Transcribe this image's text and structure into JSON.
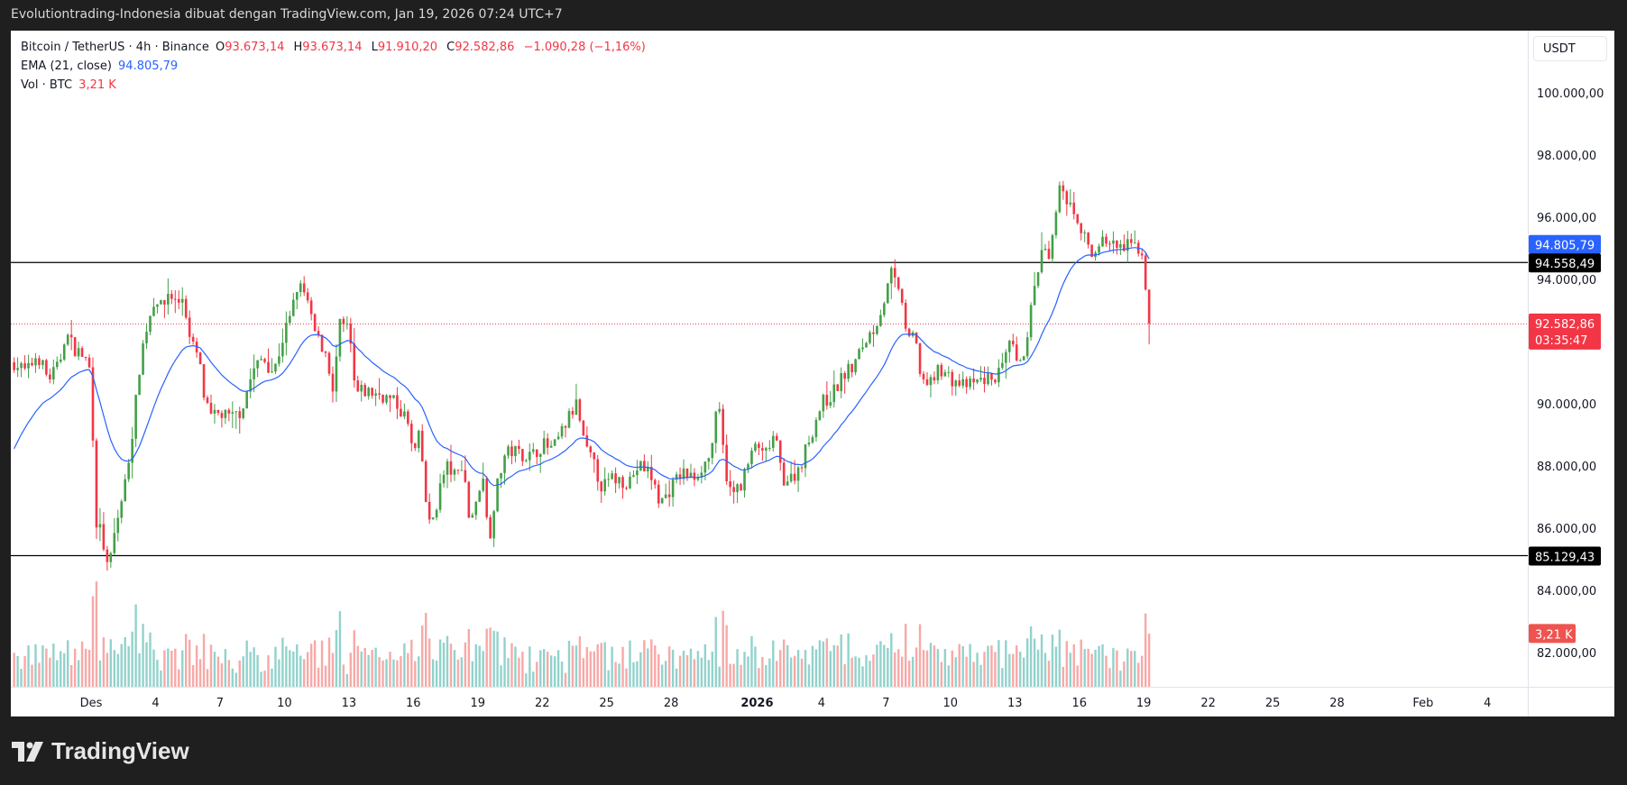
{
  "topbar": {
    "caption": "Evolutiontrading-Indonesia dibuat dengan TradingView.com, Jan 19, 2026 07:24 UTC+7"
  },
  "legend": {
    "symbol": "Bitcoin / TetherUS · 4h · Binance",
    "o_label": "O",
    "o_value": "93.673,14",
    "h_label": "H",
    "h_value": "93.673,14",
    "l_label": "L",
    "l_value": "91.910,20",
    "c_label": "C",
    "c_value": "92.582,86",
    "change": "−1.090,28 (−1,16%)",
    "ema_label": "EMA (21, close)",
    "ema_value": "94.805,79",
    "vol_label": "Vol · BTC",
    "vol_value": "3,21 K"
  },
  "price_axis": {
    "currency": "USDT",
    "ticks": [
      {
        "value": 100000,
        "label": "100.000,00"
      },
      {
        "value": 98000,
        "label": "98.000,00"
      },
      {
        "value": 96000,
        "label": "96.000,00"
      },
      {
        "value": 94000,
        "label": "94.000,00"
      },
      {
        "value": 90000,
        "label": "90.000,00"
      },
      {
        "value": 88000,
        "label": "88.000,00"
      },
      {
        "value": 86000,
        "label": "86.000,00"
      },
      {
        "value": 84000,
        "label": "84.000,00"
      },
      {
        "value": 82000,
        "label": "82.000,00"
      }
    ],
    "badges": {
      "ema": {
        "value": 94805.79,
        "label": "94.805,79",
        "color": "#2962ff"
      },
      "resistance": {
        "value": 94558.49,
        "label": "94.558,49",
        "color": "#000000"
      },
      "last": {
        "value": 92582.86,
        "label": "92.582,86",
        "countdown": "03:35:47",
        "color": "#f23645"
      },
      "support": {
        "value": 85129.43,
        "label": "85.129,43",
        "color": "#000000"
      },
      "volume": {
        "value": 3.21,
        "label": "3,21 K",
        "color": "#ef5350"
      }
    }
  },
  "time_axis": {
    "ticks": [
      {
        "day": 0,
        "label": "Des"
      },
      {
        "day": 3,
        "label": "4"
      },
      {
        "day": 6,
        "label": "7"
      },
      {
        "day": 9,
        "label": "10"
      },
      {
        "day": 12,
        "label": "13"
      },
      {
        "day": 15,
        "label": "16"
      },
      {
        "day": 18,
        "label": "19"
      },
      {
        "day": 21,
        "label": "22"
      },
      {
        "day": 24,
        "label": "25"
      },
      {
        "day": 27,
        "label": "28"
      },
      {
        "day": 31,
        "label": "2026",
        "bold": true
      },
      {
        "day": 34,
        "label": "4"
      },
      {
        "day": 37,
        "label": "7"
      },
      {
        "day": 40,
        "label": "10"
      },
      {
        "day": 43,
        "label": "13"
      },
      {
        "day": 46,
        "label": "16"
      },
      {
        "day": 49,
        "label": "19"
      },
      {
        "day": 52,
        "label": "22"
      },
      {
        "day": 55,
        "label": "25"
      },
      {
        "day": 58,
        "label": "28"
      },
      {
        "day": 62,
        "label": "Feb"
      },
      {
        "day": 65,
        "label": "4"
      }
    ]
  },
  "chart_data": {
    "type": "candlestick",
    "title": "Bitcoin / TetherUS · 4h · Binance",
    "day_origin": "Dec 1, 2025",
    "ylim": [
      80500,
      101500
    ],
    "horizontal_lines": [
      94558.49,
      85129.43
    ],
    "ema_period": 21,
    "last_candle": {
      "open": 93673.14,
      "high": 93673.14,
      "low": 91910.2,
      "close": 92582.86,
      "volume_k": 3.21
    },
    "close_path_day_price": [
      [
        -3.7,
        91400
      ],
      [
        -3,
        91000
      ],
      [
        -2.5,
        91600
      ],
      [
        -2,
        90800
      ],
      [
        -1.5,
        91200
      ],
      [
        -1.2,
        92300
      ],
      [
        -0.8,
        91800
      ],
      [
        -0.3,
        91500
      ],
      [
        0,
        91000
      ],
      [
        0.2,
        86300
      ],
      [
        0.5,
        85800
      ],
      [
        0.8,
        84500
      ],
      [
        1.0,
        85500
      ],
      [
        1.3,
        86500
      ],
      [
        1.6,
        87500
      ],
      [
        2.0,
        89500
      ],
      [
        2.3,
        91500
      ],
      [
        2.6,
        92500
      ],
      [
        3.0,
        93500
      ],
      [
        3.3,
        93000
      ],
      [
        3.6,
        93600
      ],
      [
        4.0,
        93200
      ],
      [
        4.3,
        93500
      ],
      [
        4.6,
        92000
      ],
      [
        5.0,
        91500
      ],
      [
        5.3,
        90000
      ],
      [
        5.6,
        89500
      ],
      [
        6.0,
        89700
      ],
      [
        6.5,
        89500
      ],
      [
        7.0,
        89800
      ],
      [
        7.5,
        91000
      ],
      [
        8.0,
        91500
      ],
      [
        8.5,
        91000
      ],
      [
        9.0,
        92300
      ],
      [
        9.3,
        92800
      ],
      [
        9.6,
        93800
      ],
      [
        10.0,
        93500
      ],
      [
        10.3,
        92500
      ],
      [
        10.6,
        92000
      ],
      [
        11.0,
        91600
      ],
      [
        11.3,
        90000
      ],
      [
        11.5,
        92500
      ],
      [
        12.0,
        92400
      ],
      [
        12.3,
        90300
      ],
      [
        12.7,
        90400
      ],
      [
        13.5,
        90300
      ],
      [
        14.2,
        90000
      ],
      [
        14.7,
        89500
      ],
      [
        15.0,
        88300
      ],
      [
        15.3,
        89000
      ],
      [
        15.7,
        86000
      ],
      [
        16.0,
        86500
      ],
      [
        16.3,
        87500
      ],
      [
        16.6,
        88000
      ],
      [
        17.0,
        87600
      ],
      [
        17.3,
        88200
      ],
      [
        17.6,
        86300
      ],
      [
        18.0,
        86800
      ],
      [
        18.2,
        88200
      ],
      [
        18.5,
        85500
      ],
      [
        18.8,
        87000
      ],
      [
        19.2,
        88300
      ],
      [
        19.6,
        88500
      ],
      [
        20.5,
        88300
      ],
      [
        21.0,
        88700
      ],
      [
        21.5,
        88500
      ],
      [
        22.2,
        89500
      ],
      [
        22.6,
        90000
      ],
      [
        23.0,
        88500
      ],
      [
        23.3,
        88200
      ],
      [
        23.8,
        87300
      ],
      [
        24.3,
        87600
      ],
      [
        25.0,
        87500
      ],
      [
        25.5,
        88000
      ],
      [
        26.0,
        87800
      ],
      [
        26.5,
        86800
      ],
      [
        27.0,
        87300
      ],
      [
        27.5,
        87800
      ],
      [
        28.0,
        87600
      ],
      [
        28.8,
        88300
      ],
      [
        29.2,
        90000
      ],
      [
        29.5,
        88000
      ],
      [
        29.8,
        87000
      ],
      [
        30.3,
        87500
      ],
      [
        31.0,
        88800
      ],
      [
        31.3,
        88200
      ],
      [
        31.8,
        89000
      ],
      [
        32.2,
        87600
      ],
      [
        32.6,
        87600
      ],
      [
        33.0,
        88000
      ],
      [
        33.5,
        89000
      ],
      [
        34.0,
        90000
      ],
      [
        34.5,
        90300
      ],
      [
        35.0,
        90900
      ],
      [
        35.5,
        91200
      ],
      [
        36.0,
        92000
      ],
      [
        36.5,
        92500
      ],
      [
        37.0,
        93500
      ],
      [
        37.3,
        94300
      ],
      [
        37.5,
        93600
      ],
      [
        37.8,
        93300
      ],
      [
        38.0,
        91800
      ],
      [
        38.3,
        92300
      ],
      [
        38.6,
        91000
      ],
      [
        39.0,
        90500
      ],
      [
        39.5,
        91200
      ],
      [
        40.0,
        90800
      ],
      [
        40.5,
        90600
      ],
      [
        41.0,
        90600
      ],
      [
        41.5,
        90800
      ],
      [
        42.0,
        90800
      ],
      [
        42.5,
        91200
      ],
      [
        42.8,
        92000
      ],
      [
        43.2,
        91000
      ],
      [
        43.5,
        92000
      ],
      [
        44.0,
        94000
      ],
      [
        44.3,
        95000
      ],
      [
        44.6,
        94500
      ],
      [
        45.0,
        96500
      ],
      [
        45.2,
        97200
      ],
      [
        45.4,
        96500
      ],
      [
        45.7,
        96500
      ],
      [
        46.0,
        95300
      ],
      [
        46.3,
        95400
      ],
      [
        46.6,
        94700
      ],
      [
        47.0,
        95300
      ],
      [
        47.5,
        95100
      ],
      [
        48.0,
        95000
      ],
      [
        48.5,
        95100
      ],
      [
        48.9,
        94950
      ],
      [
        49.08,
        93673.14
      ],
      [
        49.25,
        92582.86
      ]
    ]
  },
  "brand": {
    "name": "TradingView"
  }
}
